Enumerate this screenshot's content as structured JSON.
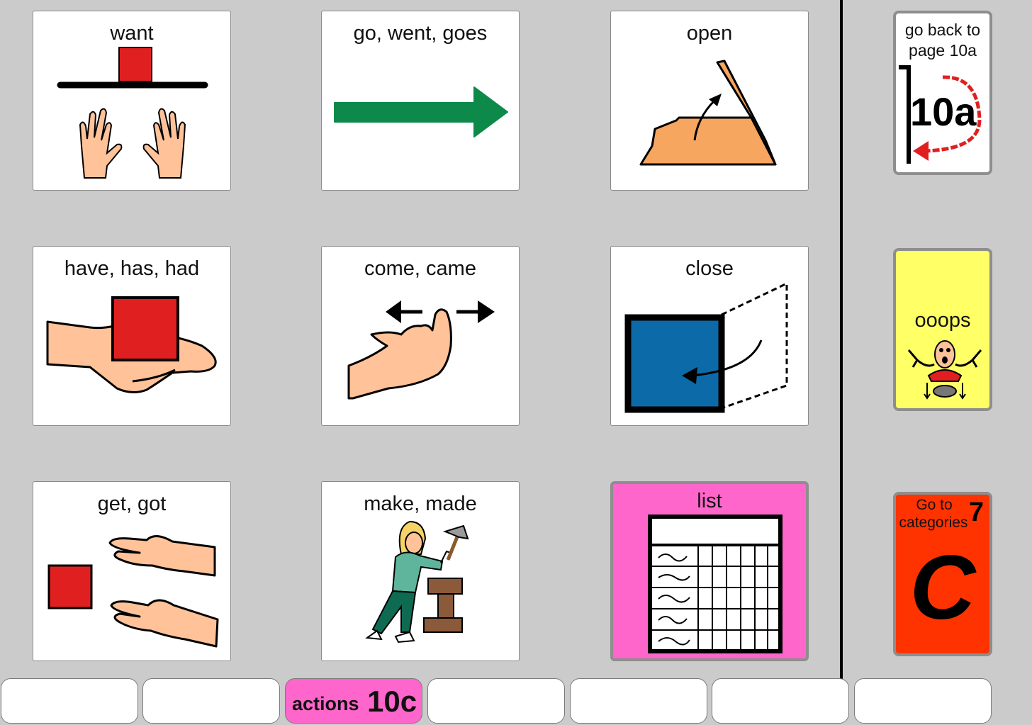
{
  "grid": {
    "want": "want",
    "go": "go, went, goes",
    "open": "open",
    "have": "have, has, had",
    "come": "come, came",
    "close": "close",
    "get": "get, got",
    "make": "make,  made",
    "list": "list"
  },
  "side": {
    "back_line1": "go back to",
    "back_line2": "page 10a",
    "back_page": "10a",
    "oops": "ooops",
    "cat_line1": "Go to",
    "cat_line2": "categories",
    "cat_number": "7",
    "cat_letter": "C"
  },
  "tabs": {
    "active_word": "actions",
    "active_page": "10c"
  },
  "colors": {
    "page_bg": "#cbcbcb",
    "list_pink": "#ff66cc",
    "oops_yellow": "#ffff66",
    "categories_red": "#ff3300",
    "tab_active": "#ff66cc"
  }
}
